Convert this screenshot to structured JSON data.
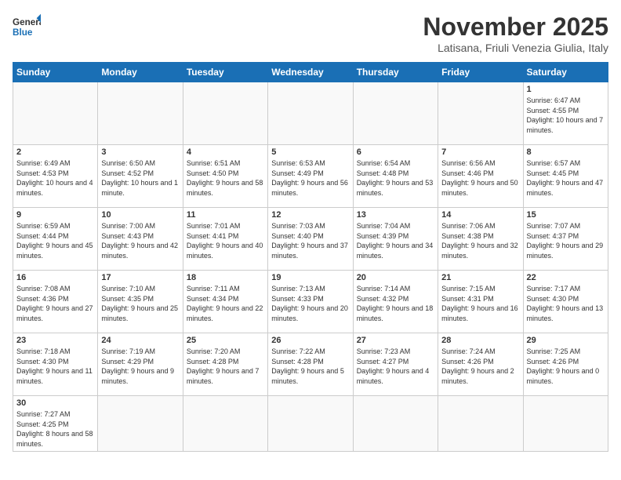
{
  "header": {
    "logo_general": "General",
    "logo_blue": "Blue",
    "title": "November 2025",
    "subtitle": "Latisana, Friuli Venezia Giulia, Italy"
  },
  "days_of_week": [
    "Sunday",
    "Monday",
    "Tuesday",
    "Wednesday",
    "Thursday",
    "Friday",
    "Saturday"
  ],
  "weeks": [
    [
      {
        "day": "",
        "info": ""
      },
      {
        "day": "",
        "info": ""
      },
      {
        "day": "",
        "info": ""
      },
      {
        "day": "",
        "info": ""
      },
      {
        "day": "",
        "info": ""
      },
      {
        "day": "",
        "info": ""
      },
      {
        "day": "1",
        "info": "Sunrise: 6:47 AM\nSunset: 4:55 PM\nDaylight: 10 hours and 7 minutes."
      }
    ],
    [
      {
        "day": "2",
        "info": "Sunrise: 6:49 AM\nSunset: 4:53 PM\nDaylight: 10 hours and 4 minutes."
      },
      {
        "day": "3",
        "info": "Sunrise: 6:50 AM\nSunset: 4:52 PM\nDaylight: 10 hours and 1 minute."
      },
      {
        "day": "4",
        "info": "Sunrise: 6:51 AM\nSunset: 4:50 PM\nDaylight: 9 hours and 58 minutes."
      },
      {
        "day": "5",
        "info": "Sunrise: 6:53 AM\nSunset: 4:49 PM\nDaylight: 9 hours and 56 minutes."
      },
      {
        "day": "6",
        "info": "Sunrise: 6:54 AM\nSunset: 4:48 PM\nDaylight: 9 hours and 53 minutes."
      },
      {
        "day": "7",
        "info": "Sunrise: 6:56 AM\nSunset: 4:46 PM\nDaylight: 9 hours and 50 minutes."
      },
      {
        "day": "8",
        "info": "Sunrise: 6:57 AM\nSunset: 4:45 PM\nDaylight: 9 hours and 47 minutes."
      }
    ],
    [
      {
        "day": "9",
        "info": "Sunrise: 6:59 AM\nSunset: 4:44 PM\nDaylight: 9 hours and 45 minutes."
      },
      {
        "day": "10",
        "info": "Sunrise: 7:00 AM\nSunset: 4:43 PM\nDaylight: 9 hours and 42 minutes."
      },
      {
        "day": "11",
        "info": "Sunrise: 7:01 AM\nSunset: 4:41 PM\nDaylight: 9 hours and 40 minutes."
      },
      {
        "day": "12",
        "info": "Sunrise: 7:03 AM\nSunset: 4:40 PM\nDaylight: 9 hours and 37 minutes."
      },
      {
        "day": "13",
        "info": "Sunrise: 7:04 AM\nSunset: 4:39 PM\nDaylight: 9 hours and 34 minutes."
      },
      {
        "day": "14",
        "info": "Sunrise: 7:06 AM\nSunset: 4:38 PM\nDaylight: 9 hours and 32 minutes."
      },
      {
        "day": "15",
        "info": "Sunrise: 7:07 AM\nSunset: 4:37 PM\nDaylight: 9 hours and 29 minutes."
      }
    ],
    [
      {
        "day": "16",
        "info": "Sunrise: 7:08 AM\nSunset: 4:36 PM\nDaylight: 9 hours and 27 minutes."
      },
      {
        "day": "17",
        "info": "Sunrise: 7:10 AM\nSunset: 4:35 PM\nDaylight: 9 hours and 25 minutes."
      },
      {
        "day": "18",
        "info": "Sunrise: 7:11 AM\nSunset: 4:34 PM\nDaylight: 9 hours and 22 minutes."
      },
      {
        "day": "19",
        "info": "Sunrise: 7:13 AM\nSunset: 4:33 PM\nDaylight: 9 hours and 20 minutes."
      },
      {
        "day": "20",
        "info": "Sunrise: 7:14 AM\nSunset: 4:32 PM\nDaylight: 9 hours and 18 minutes."
      },
      {
        "day": "21",
        "info": "Sunrise: 7:15 AM\nSunset: 4:31 PM\nDaylight: 9 hours and 16 minutes."
      },
      {
        "day": "22",
        "info": "Sunrise: 7:17 AM\nSunset: 4:30 PM\nDaylight: 9 hours and 13 minutes."
      }
    ],
    [
      {
        "day": "23",
        "info": "Sunrise: 7:18 AM\nSunset: 4:30 PM\nDaylight: 9 hours and 11 minutes."
      },
      {
        "day": "24",
        "info": "Sunrise: 7:19 AM\nSunset: 4:29 PM\nDaylight: 9 hours and 9 minutes."
      },
      {
        "day": "25",
        "info": "Sunrise: 7:20 AM\nSunset: 4:28 PM\nDaylight: 9 hours and 7 minutes."
      },
      {
        "day": "26",
        "info": "Sunrise: 7:22 AM\nSunset: 4:28 PM\nDaylight: 9 hours and 5 minutes."
      },
      {
        "day": "27",
        "info": "Sunrise: 7:23 AM\nSunset: 4:27 PM\nDaylight: 9 hours and 4 minutes."
      },
      {
        "day": "28",
        "info": "Sunrise: 7:24 AM\nSunset: 4:26 PM\nDaylight: 9 hours and 2 minutes."
      },
      {
        "day": "29",
        "info": "Sunrise: 7:25 AM\nSunset: 4:26 PM\nDaylight: 9 hours and 0 minutes."
      }
    ],
    [
      {
        "day": "30",
        "info": "Sunrise: 7:27 AM\nSunset: 4:25 PM\nDaylight: 8 hours and 58 minutes."
      },
      {
        "day": "",
        "info": ""
      },
      {
        "day": "",
        "info": ""
      },
      {
        "day": "",
        "info": ""
      },
      {
        "day": "",
        "info": ""
      },
      {
        "day": "",
        "info": ""
      },
      {
        "day": "",
        "info": ""
      }
    ]
  ]
}
